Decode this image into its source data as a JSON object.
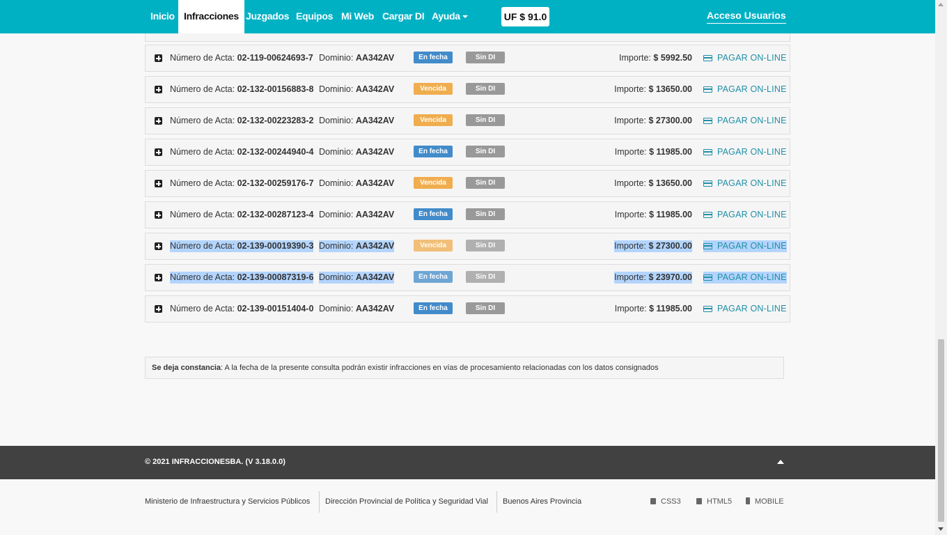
{
  "nav": {
    "items": [
      {
        "label": "Inicio"
      },
      {
        "label": "Infracciones"
      },
      {
        "label": "Juzgados"
      },
      {
        "label": "Equipos"
      },
      {
        "label": "Mi Web"
      },
      {
        "label": "Cargar DI"
      },
      {
        "label": "Ayuda"
      }
    ],
    "uf": "UF $ 91.0",
    "login": "Acceso Usuarios"
  },
  "labels": {
    "acta": "Número de Acta:",
    "dominio": "Dominio:",
    "importe": "Importe:",
    "pay": "PAGAR ON-LINE"
  },
  "actas": [
    {
      "numero": "02-119-00624693-7",
      "dominio": "AA342AV",
      "estado": "En fecha",
      "di": "Sin DI",
      "importe": "$ 5992.50"
    },
    {
      "numero": "02-132-00156883-8",
      "dominio": "AA342AV",
      "estado": "Vencida",
      "di": "Sin DI",
      "importe": "$ 13650.00"
    },
    {
      "numero": "02-132-00223283-2",
      "dominio": "AA342AV",
      "estado": "Vencida",
      "di": "Sin DI",
      "importe": "$ 27300.00"
    },
    {
      "numero": "02-132-00244940-4",
      "dominio": "AA342AV",
      "estado": "En fecha",
      "di": "Sin DI",
      "importe": "$ 11985.00"
    },
    {
      "numero": "02-132-00259176-7",
      "dominio": "AA342AV",
      "estado": "Vencida",
      "di": "Sin DI",
      "importe": "$ 13650.00"
    },
    {
      "numero": "02-132-00287123-4",
      "dominio": "AA342AV",
      "estado": "En fecha",
      "di": "Sin DI",
      "importe": "$ 11985.00"
    },
    {
      "numero": "02-139-00019390-3",
      "dominio": "AA342AV",
      "estado": "Vencida",
      "di": "Sin DI",
      "importe": "$ 27300.00"
    },
    {
      "numero": "02-139-00087319-6",
      "dominio": "AA342AV",
      "estado": "En fecha",
      "di": "Sin DI",
      "importe": "$ 23970.00"
    },
    {
      "numero": "02-139-00151404-0",
      "dominio": "AA342AV",
      "estado": "En fecha",
      "di": "Sin DI",
      "importe": "$ 11985.00"
    }
  ],
  "status_colors": {
    "En fecha": "#428bca",
    "Vencida": "#f0ad4e"
  },
  "notice": {
    "bold": "Se deja constancia",
    "text": ": A la fecha de la presente consulta podrán existir infracciones en vías de procesamiento relacionadas con los datos consignados"
  },
  "footer": {
    "copyright": "© 2021 INFRACCIONESBA. (V 3.18.0.0)",
    "links": [
      "Ministerio de Infraestructura y Servicios Públicos",
      "Dirección Provincial de Política y Seguridad Vial",
      "Buenos Aires Provincia"
    ],
    "tech": [
      "CSS3",
      "HTML5",
      "MOBILE"
    ]
  }
}
